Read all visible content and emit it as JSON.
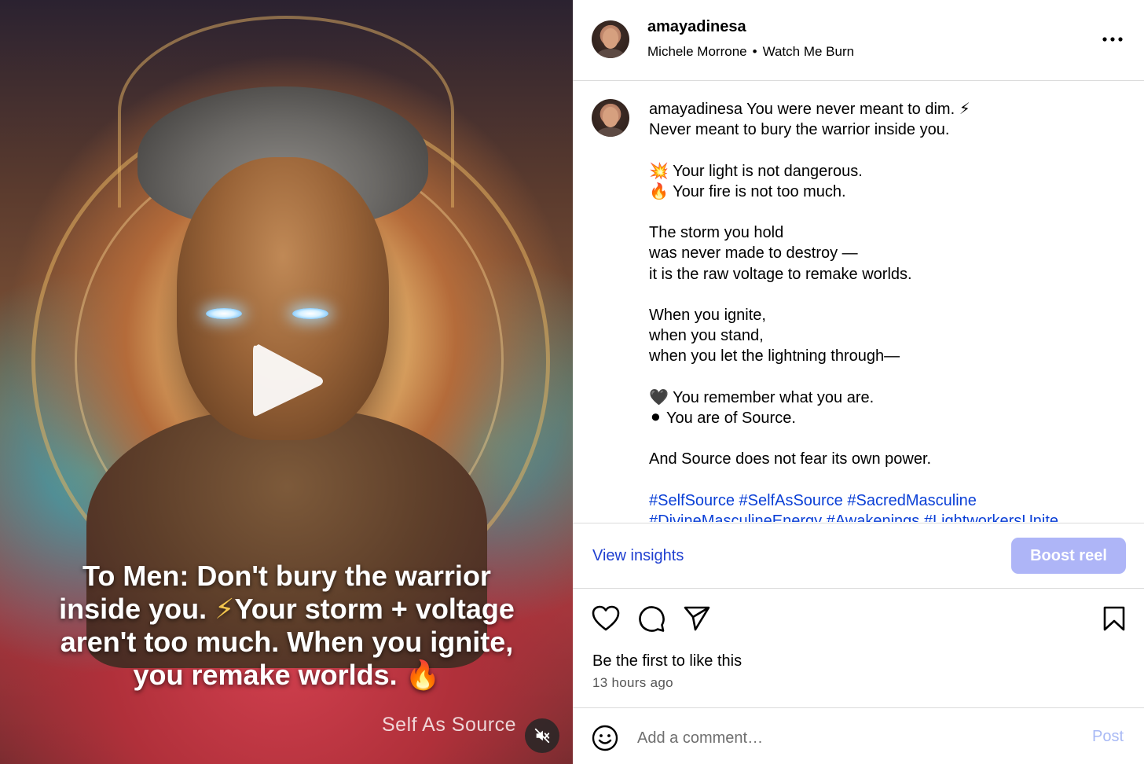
{
  "media": {
    "overlay_line1": "To Men: Don't bury the warrior",
    "overlay_line2a": "inside you.",
    "overlay_bolt": "⚡",
    "overlay_line2b": "Your storm + voltage",
    "overlay_line3": "aren't too much. When you ignite,",
    "overlay_line4": "you remake worlds. 🔥",
    "watermark": "Self As Source",
    "play_icon": "play-icon",
    "mute_icon": "muted-speaker-icon"
  },
  "header": {
    "username": "amayadinesa",
    "artist": "Michele Morrone",
    "separator": "•",
    "song": "Watch Me Burn",
    "more_icon": "more-options-icon"
  },
  "caption": {
    "username": "amayadinesa",
    "lines": [
      "You were never meant to dim. ⚡",
      "Never meant to bury the warrior inside you.",
      "",
      "💥 Your light is not dangerous.",
      "🔥 Your fire is not too much.",
      "",
      "The storm you hold",
      "was never made to destroy —",
      "it is the raw voltage to remake worlds.",
      "",
      "When you ignite,",
      "when you stand,",
      "when you let the lightning through—",
      "",
      "🖤 You remember what you are.",
      "⚫ You are of Source.",
      "",
      "And Source does not fear its own power.",
      ""
    ],
    "hashtags_line1": "#SelfSource #SelfAsSource #SacredMasculine",
    "hashtags_line2": "#DivineMasculineEnergy #Awakenings #LightworkersUnite"
  },
  "actions": {
    "view_insights": "View insights",
    "boost": "Boost reel",
    "icons": [
      "heart-icon",
      "comment-icon",
      "share-icon",
      "bookmark-icon"
    ]
  },
  "engagement": {
    "likes_text": "Be the first to like this",
    "time": "13 hours ago"
  },
  "comment": {
    "placeholder": "Add a comment…",
    "post_label": "Post",
    "emoji_icon": "emoji-icon"
  },
  "colors": {
    "link": "#1f3fd0",
    "hashtag": "#0a3fd6",
    "boost_bg": "#aeb5f7",
    "post_disabled": "#a8b9f5",
    "divider": "#dbdbdb"
  }
}
